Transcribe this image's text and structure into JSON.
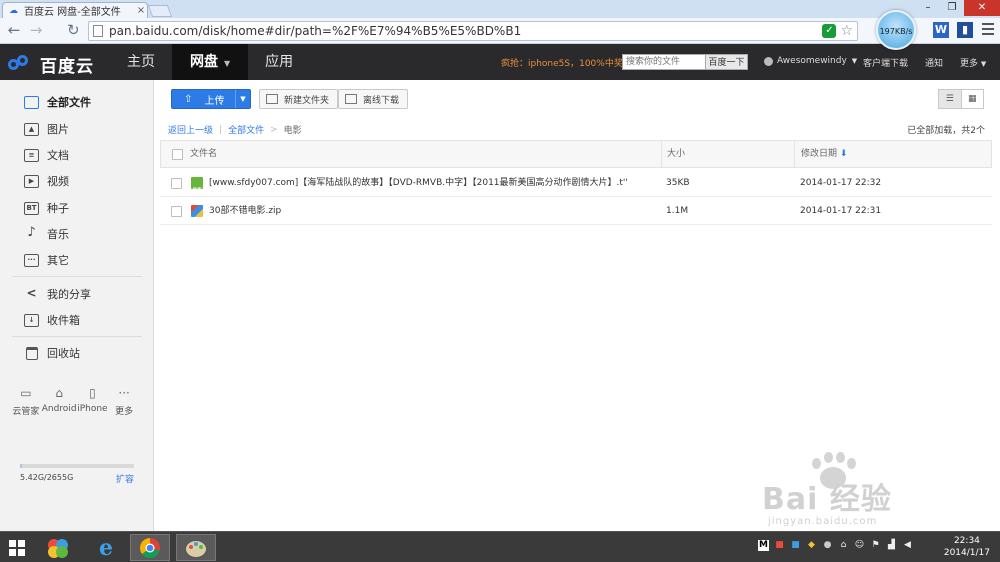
{
  "browser": {
    "tab_title": "百度云 网盘-全部文件",
    "url": "pan.baidu.com/disk/home#dir/path=%2F%E7%94%B5%E5%BD%B1",
    "speed_badge": "197KB/s"
  },
  "header": {
    "logo_text": "百度云",
    "nav": [
      {
        "label": "主页"
      },
      {
        "label": "网盘"
      },
      {
        "label": "应用"
      }
    ],
    "promo": "疯抢：iphone5S，100%中奖",
    "search_placeholder": "搜索你的文件",
    "search_button": "百度一下",
    "username": "Awesomewindy",
    "links": [
      "客户端下载",
      "通知",
      "更多"
    ]
  },
  "sidebar": {
    "items": [
      {
        "label": "全部文件",
        "icon": "folder-icon"
      },
      {
        "label": "图片",
        "icon": "image-icon"
      },
      {
        "label": "文档",
        "icon": "document-icon"
      },
      {
        "label": "视频",
        "icon": "video-icon"
      },
      {
        "label": "种子",
        "icon": "bt-icon",
        "glyph": "BT"
      },
      {
        "label": "音乐",
        "icon": "music-icon"
      },
      {
        "label": "其它",
        "icon": "other-icon"
      },
      {
        "label": "我的分享",
        "icon": "share-icon"
      },
      {
        "label": "收件箱",
        "icon": "inbox-icon"
      },
      {
        "label": "回收站",
        "icon": "trash-icon"
      }
    ],
    "devices": [
      {
        "label": "云管家",
        "icon": "monitor-icon"
      },
      {
        "label": "Android",
        "icon": "android-icon"
      },
      {
        "label": "iPhone",
        "icon": "phone-icon"
      },
      {
        "label": "更多",
        "icon": "more-icon"
      }
    ],
    "quota_text": "5.42G/2655G",
    "quota_fraction": 0.002,
    "expand_label": "扩容"
  },
  "toolbar": {
    "upload_label": "上传",
    "new_folder_label": "新建文件夹",
    "offline_download_label": "离线下载"
  },
  "breadcrumb": {
    "back_label": "返回上一级",
    "root_label": "全部文件",
    "separator": ">",
    "current": "电影"
  },
  "status_text": "已全部加载，共2个",
  "table": {
    "headers": {
      "name": "文件名",
      "size": "大小",
      "modified": "修改日期"
    },
    "rows": [
      {
        "type": "bt",
        "name": "[www.sfdy007.com]【海军陆战队的故事】【DVD-RMVB.中字】【2011最新美国高分动作剧情大片】.t''",
        "size": "35KB",
        "modified": "2014-01-17 22:32"
      },
      {
        "type": "zip",
        "name": "30部不错电影.zip",
        "size": "1.1M",
        "modified": "2014-01-17 22:31"
      }
    ]
  },
  "watermark": {
    "brand": "Bai 经验",
    "url": "jingyan.baidu.com"
  },
  "taskbar": {
    "time": "22:34",
    "date": "2014/1/17"
  }
}
